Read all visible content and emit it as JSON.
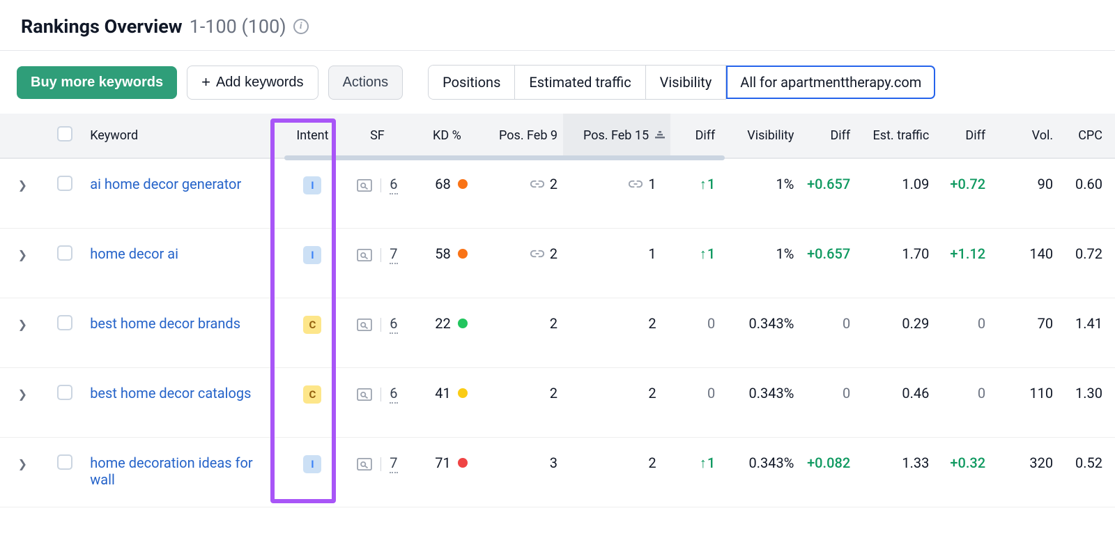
{
  "header": {
    "title": "Rankings Overview",
    "range": "1-100",
    "total": "(100)"
  },
  "toolbar": {
    "buy": "Buy more keywords",
    "add": "Add keywords",
    "actions": "Actions",
    "segments": [
      "Positions",
      "Estimated traffic",
      "Visibility",
      "All for apartmenttherapy.com"
    ],
    "selected_segment": 3
  },
  "columns": {
    "keyword": "Keyword",
    "intent": "Intent",
    "sf": "SF",
    "kd": "KD %",
    "pos1": "Pos. Feb 9",
    "pos2": "Pos. Feb 15",
    "diff1": "Diff",
    "vis": "Visibility",
    "diff2": "Diff",
    "est": "Est. traffic",
    "diff3": "Diff",
    "vol": "Vol.",
    "cpc": "CPC"
  },
  "rows": [
    {
      "keyword": "ai home decor generator",
      "intent": "I",
      "sf": "6",
      "kd": "68",
      "kd_color": "orange",
      "pos1": "2",
      "pos1_link": true,
      "pos2": "1",
      "pos2_link": true,
      "diff1": "1",
      "diff1_up": true,
      "vis": "1%",
      "diff2": "+0.657",
      "diff2_up": true,
      "est": "1.09",
      "diff3": "+0.72",
      "diff3_up": true,
      "vol": "90",
      "cpc": "0.60"
    },
    {
      "keyword": "home decor ai",
      "intent": "I",
      "sf": "7",
      "kd": "58",
      "kd_color": "orange",
      "pos1": "2",
      "pos1_link": true,
      "pos2": "1",
      "pos2_link": false,
      "diff1": "1",
      "diff1_up": true,
      "vis": "1%",
      "diff2": "+0.657",
      "diff2_up": true,
      "est": "1.70",
      "diff3": "+1.12",
      "diff3_up": true,
      "vol": "140",
      "cpc": "0.72"
    },
    {
      "keyword": "best home decor brands",
      "intent": "C",
      "sf": "6",
      "kd": "22",
      "kd_color": "green",
      "pos1": "2",
      "pos1_link": false,
      "pos2": "2",
      "pos2_link": false,
      "diff1": "0",
      "diff1_up": false,
      "vis": "0.343%",
      "diff2": "0",
      "diff2_up": false,
      "est": "0.29",
      "diff3": "0",
      "diff3_up": false,
      "vol": "70",
      "cpc": "1.41"
    },
    {
      "keyword": "best home decor catalogs",
      "intent": "C",
      "sf": "6",
      "kd": "41",
      "kd_color": "yellow",
      "pos1": "2",
      "pos1_link": false,
      "pos2": "2",
      "pos2_link": false,
      "diff1": "0",
      "diff1_up": false,
      "vis": "0.343%",
      "diff2": "0",
      "diff2_up": false,
      "est": "0.46",
      "diff3": "0",
      "diff3_up": false,
      "vol": "110",
      "cpc": "1.30"
    },
    {
      "keyword": "home decoration ideas for wall",
      "intent": "I",
      "sf": "7",
      "kd": "71",
      "kd_color": "red",
      "pos1": "3",
      "pos1_link": false,
      "pos2": "2",
      "pos2_link": false,
      "diff1": "1",
      "diff1_up": true,
      "vis": "0.343%",
      "diff2": "+0.082",
      "diff2_up": true,
      "est": "1.33",
      "diff3": "+0.32",
      "diff3_up": true,
      "vol": "320",
      "cpc": "0.52"
    }
  ]
}
